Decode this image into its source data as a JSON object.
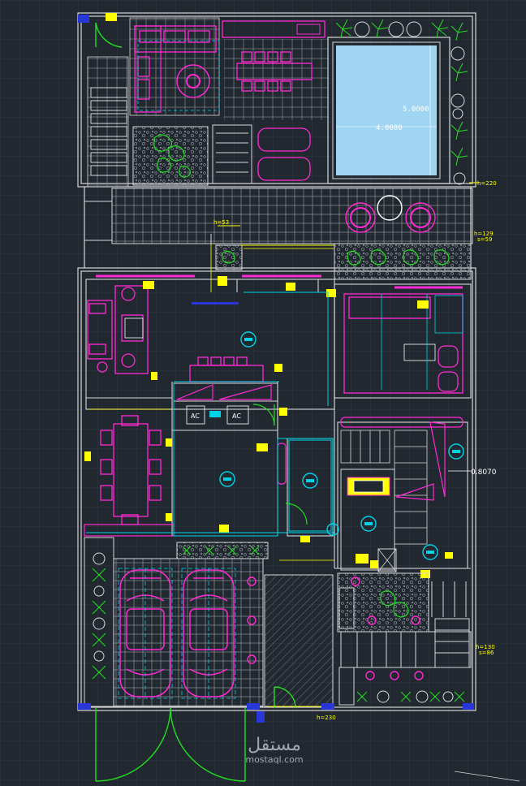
{
  "plan": {
    "pool_width_label": "4.0000",
    "pool_length_label": "5.0000",
    "stair_dim_label": "0.8070",
    "ac_label_1": "AC",
    "ac_label_2": "AC",
    "level_h220": "h=220",
    "level_h53": "h=53",
    "level_h129": "h=129",
    "level_s59": "s=59",
    "level_h130": "h=130",
    "level_s86": "s=86",
    "level_h230": "h=230"
  },
  "watermark": {
    "arabic": "مستقل",
    "latin": "mostaql.com"
  },
  "colors": {
    "background": "#212830",
    "grid": "#2d3540",
    "wall": "#d8d8d8",
    "furniture": "#ff2ad4",
    "cyan": "#00d2e6",
    "yellow": "#ffff00",
    "green": "#22dd22",
    "pool": "#9fd4f2",
    "dim": "#ffffff"
  }
}
